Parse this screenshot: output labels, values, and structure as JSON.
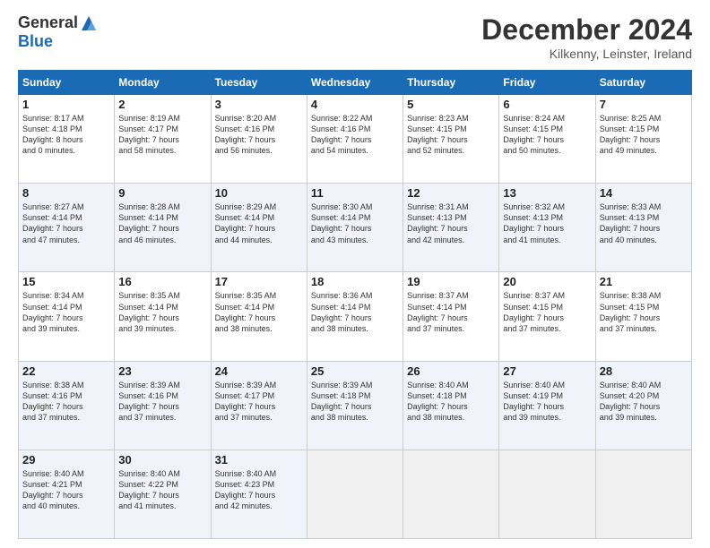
{
  "header": {
    "logo_general": "General",
    "logo_blue": "Blue",
    "month_title": "December 2024",
    "location": "Kilkenny, Leinster, Ireland"
  },
  "days_of_week": [
    "Sunday",
    "Monday",
    "Tuesday",
    "Wednesday",
    "Thursday",
    "Friday",
    "Saturday"
  ],
  "weeks": [
    [
      {
        "day": "1",
        "info": "Sunrise: 8:17 AM\nSunset: 4:18 PM\nDaylight: 8 hours\nand 0 minutes."
      },
      {
        "day": "2",
        "info": "Sunrise: 8:19 AM\nSunset: 4:17 PM\nDaylight: 7 hours\nand 58 minutes."
      },
      {
        "day": "3",
        "info": "Sunrise: 8:20 AM\nSunset: 4:16 PM\nDaylight: 7 hours\nand 56 minutes."
      },
      {
        "day": "4",
        "info": "Sunrise: 8:22 AM\nSunset: 4:16 PM\nDaylight: 7 hours\nand 54 minutes."
      },
      {
        "day": "5",
        "info": "Sunrise: 8:23 AM\nSunset: 4:15 PM\nDaylight: 7 hours\nand 52 minutes."
      },
      {
        "day": "6",
        "info": "Sunrise: 8:24 AM\nSunset: 4:15 PM\nDaylight: 7 hours\nand 50 minutes."
      },
      {
        "day": "7",
        "info": "Sunrise: 8:25 AM\nSunset: 4:15 PM\nDaylight: 7 hours\nand 49 minutes."
      }
    ],
    [
      {
        "day": "8",
        "info": "Sunrise: 8:27 AM\nSunset: 4:14 PM\nDaylight: 7 hours\nand 47 minutes."
      },
      {
        "day": "9",
        "info": "Sunrise: 8:28 AM\nSunset: 4:14 PM\nDaylight: 7 hours\nand 46 minutes."
      },
      {
        "day": "10",
        "info": "Sunrise: 8:29 AM\nSunset: 4:14 PM\nDaylight: 7 hours\nand 44 minutes."
      },
      {
        "day": "11",
        "info": "Sunrise: 8:30 AM\nSunset: 4:14 PM\nDaylight: 7 hours\nand 43 minutes."
      },
      {
        "day": "12",
        "info": "Sunrise: 8:31 AM\nSunset: 4:13 PM\nDaylight: 7 hours\nand 42 minutes."
      },
      {
        "day": "13",
        "info": "Sunrise: 8:32 AM\nSunset: 4:13 PM\nDaylight: 7 hours\nand 41 minutes."
      },
      {
        "day": "14",
        "info": "Sunrise: 8:33 AM\nSunset: 4:13 PM\nDaylight: 7 hours\nand 40 minutes."
      }
    ],
    [
      {
        "day": "15",
        "info": "Sunrise: 8:34 AM\nSunset: 4:14 PM\nDaylight: 7 hours\nand 39 minutes."
      },
      {
        "day": "16",
        "info": "Sunrise: 8:35 AM\nSunset: 4:14 PM\nDaylight: 7 hours\nand 39 minutes."
      },
      {
        "day": "17",
        "info": "Sunrise: 8:35 AM\nSunset: 4:14 PM\nDaylight: 7 hours\nand 38 minutes."
      },
      {
        "day": "18",
        "info": "Sunrise: 8:36 AM\nSunset: 4:14 PM\nDaylight: 7 hours\nand 38 minutes."
      },
      {
        "day": "19",
        "info": "Sunrise: 8:37 AM\nSunset: 4:14 PM\nDaylight: 7 hours\nand 37 minutes."
      },
      {
        "day": "20",
        "info": "Sunrise: 8:37 AM\nSunset: 4:15 PM\nDaylight: 7 hours\nand 37 minutes."
      },
      {
        "day": "21",
        "info": "Sunrise: 8:38 AM\nSunset: 4:15 PM\nDaylight: 7 hours\nand 37 minutes."
      }
    ],
    [
      {
        "day": "22",
        "info": "Sunrise: 8:38 AM\nSunset: 4:16 PM\nDaylight: 7 hours\nand 37 minutes."
      },
      {
        "day": "23",
        "info": "Sunrise: 8:39 AM\nSunset: 4:16 PM\nDaylight: 7 hours\nand 37 minutes."
      },
      {
        "day": "24",
        "info": "Sunrise: 8:39 AM\nSunset: 4:17 PM\nDaylight: 7 hours\nand 37 minutes."
      },
      {
        "day": "25",
        "info": "Sunrise: 8:39 AM\nSunset: 4:18 PM\nDaylight: 7 hours\nand 38 minutes."
      },
      {
        "day": "26",
        "info": "Sunrise: 8:40 AM\nSunset: 4:18 PM\nDaylight: 7 hours\nand 38 minutes."
      },
      {
        "day": "27",
        "info": "Sunrise: 8:40 AM\nSunset: 4:19 PM\nDaylight: 7 hours\nand 39 minutes."
      },
      {
        "day": "28",
        "info": "Sunrise: 8:40 AM\nSunset: 4:20 PM\nDaylight: 7 hours\nand 39 minutes."
      }
    ],
    [
      {
        "day": "29",
        "info": "Sunrise: 8:40 AM\nSunset: 4:21 PM\nDaylight: 7 hours\nand 40 minutes."
      },
      {
        "day": "30",
        "info": "Sunrise: 8:40 AM\nSunset: 4:22 PM\nDaylight: 7 hours\nand 41 minutes."
      },
      {
        "day": "31",
        "info": "Sunrise: 8:40 AM\nSunset: 4:23 PM\nDaylight: 7 hours\nand 42 minutes."
      },
      {
        "day": "",
        "info": ""
      },
      {
        "day": "",
        "info": ""
      },
      {
        "day": "",
        "info": ""
      },
      {
        "day": "",
        "info": ""
      }
    ]
  ]
}
